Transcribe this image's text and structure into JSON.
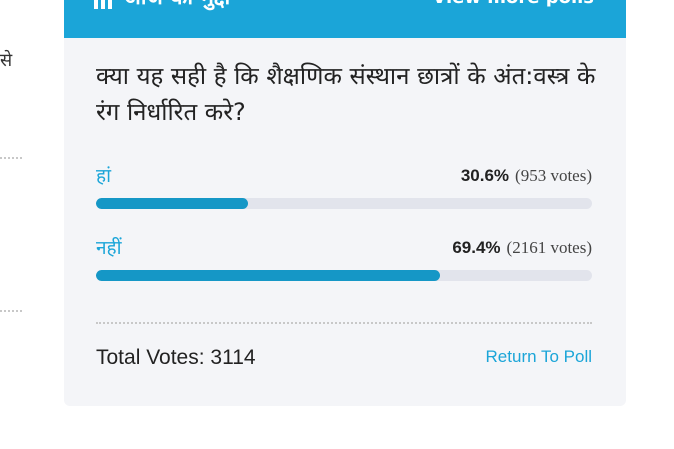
{
  "sidebar": {
    "fragment": "से"
  },
  "header": {
    "title": "आज का मुद्दा",
    "link": "View more polls"
  },
  "poll": {
    "question": "क्या यह सही है कि शैक्षणिक संस्थान छात्रों के अंत:वस्त्र के रंग निर्धारित करे?",
    "options": [
      {
        "label": "हां",
        "percent": "30.6%",
        "votes": "(953 votes)",
        "share": 0.306
      },
      {
        "label": "नहीं",
        "percent": "69.4%",
        "votes": "(2161 votes)",
        "share": 0.694
      }
    ],
    "total_votes": "Total Votes: 3114",
    "return_label": "Return To Poll"
  },
  "colors": {
    "accent": "#1ba5d8",
    "bar_fill": "#1597c6",
    "bar_track": "#e2e4ec",
    "card_bg": "#f4f5f8"
  }
}
